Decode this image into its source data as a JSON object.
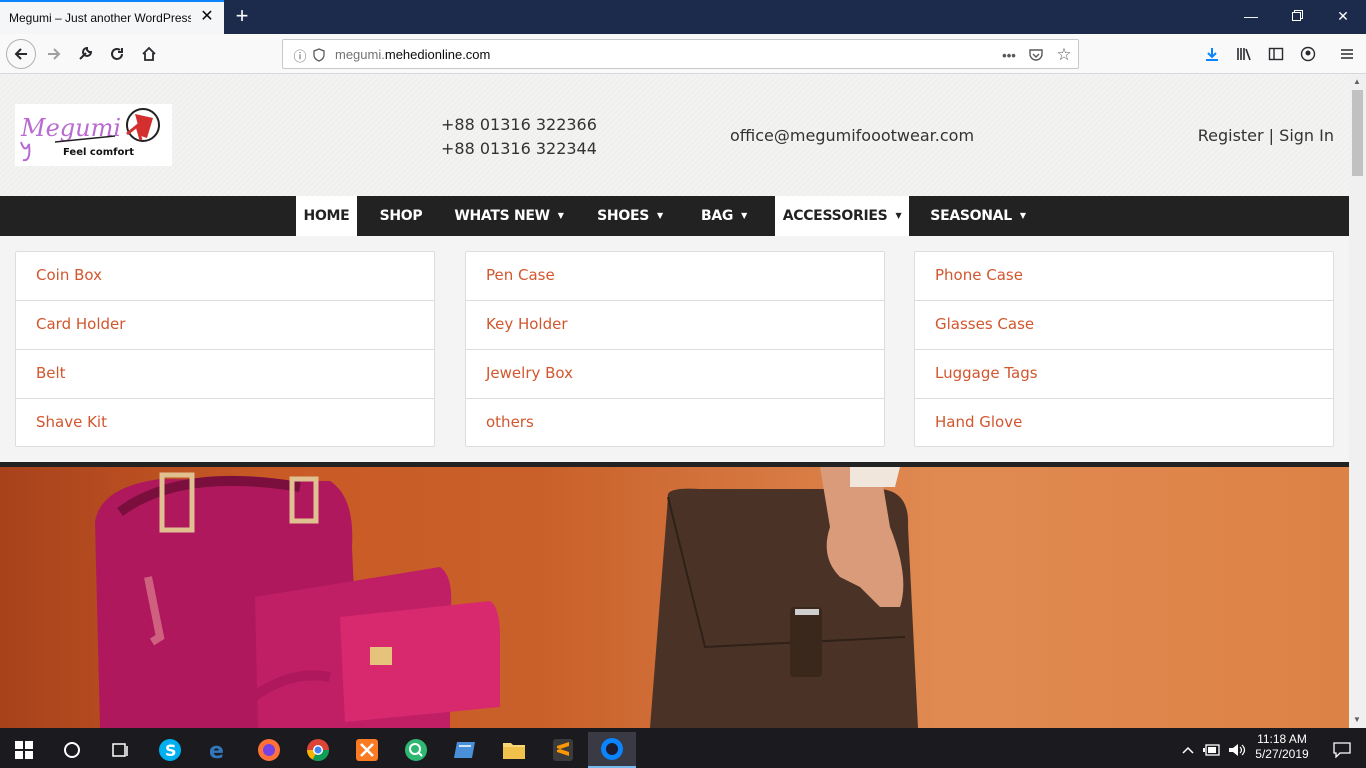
{
  "browser": {
    "tab_title": "Megumi – Just another WordPress s",
    "url_prefix": "megumi.",
    "url_domain": "mehedionline.com"
  },
  "header": {
    "logo_text": "Megumi",
    "logo_tagline": "Feel comfort",
    "phone_1": "+88 01316 322366",
    "phone_2": "+88 01316 322344",
    "email": "office@megumifoootwear.com",
    "register": "Register",
    "separator": " | ",
    "sign_in": "Sign In"
  },
  "menu": [
    {
      "label": "HOME",
      "dropdown": false,
      "active": true
    },
    {
      "label": "SHOP",
      "dropdown": false,
      "active": false
    },
    {
      "label": "WHATS NEW",
      "dropdown": true,
      "active": false
    },
    {
      "label": "SHOES",
      "dropdown": true,
      "active": false
    },
    {
      "label": "BAG",
      "dropdown": true,
      "active": false
    },
    {
      "label": "ACCESSORIES",
      "dropdown": true,
      "active": true
    },
    {
      "label": "SEASONAL",
      "dropdown": true,
      "active": false
    }
  ],
  "accessories_menu": {
    "col1": [
      "Coin Box",
      "Card Holder",
      "Belt",
      "Shave Kit"
    ],
    "col2": [
      "Pen Case",
      "Key Holder",
      "Jewelry Box",
      "others"
    ],
    "col3": [
      "Phone Case",
      "Glasses Case",
      "Luggage Tags",
      "Hand Glove"
    ]
  },
  "taskbar": {
    "time": "11:18 AM",
    "date": "5/27/2019"
  },
  "colors": {
    "link": "#d2562e",
    "nav_bg": "#222222",
    "tab_accent": "#0a84ff"
  }
}
